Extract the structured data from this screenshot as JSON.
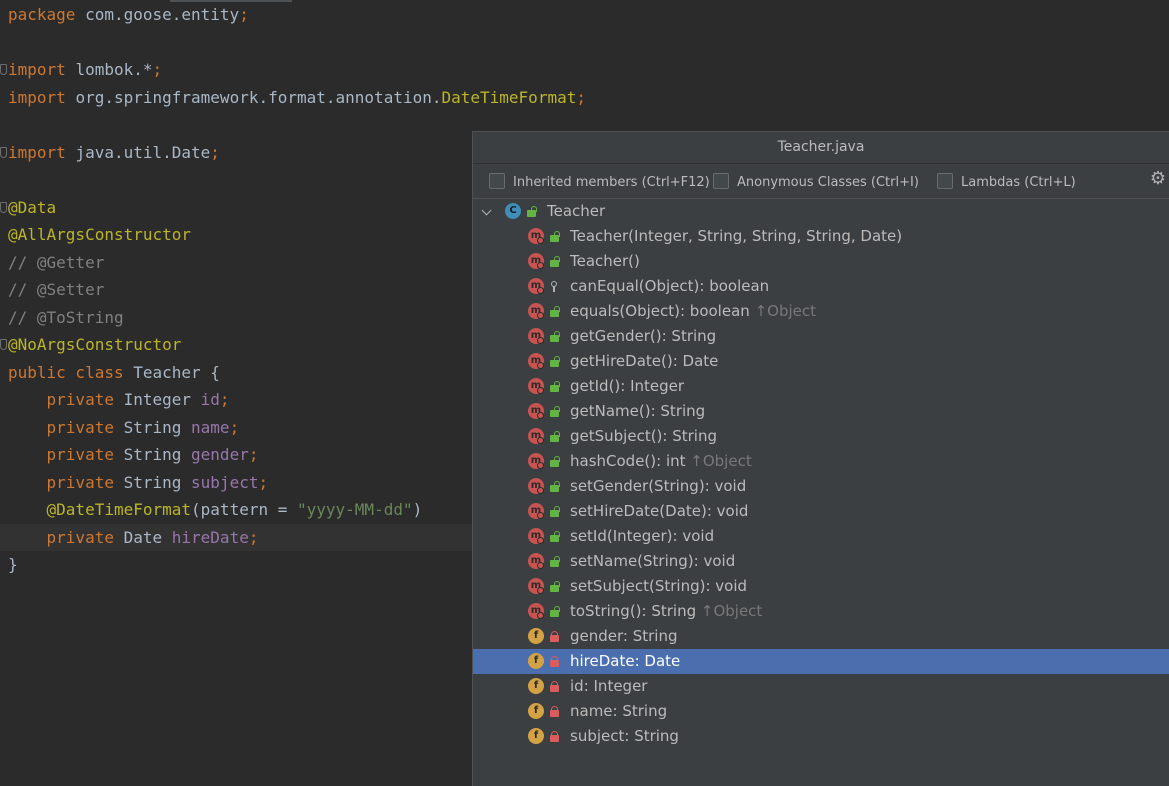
{
  "editor": {
    "lines": [
      {
        "segments": [
          {
            "t": "package ",
            "c": "kw"
          },
          {
            "t": "com.goose.entity",
            "c": ""
          },
          {
            "t": ";",
            "c": "kw"
          }
        ]
      },
      {
        "segments": []
      },
      {
        "mark": true,
        "segments": [
          {
            "t": "import ",
            "c": "kw"
          },
          {
            "t": "lombok.*",
            "c": ""
          },
          {
            "t": ";",
            "c": "kw"
          }
        ]
      },
      {
        "segments": [
          {
            "t": "import ",
            "c": "kw"
          },
          {
            "t": "org.springframework.format.annotation.",
            "c": ""
          },
          {
            "t": "DateTimeFormat",
            "c": "typ"
          },
          {
            "t": ";",
            "c": "kw"
          }
        ]
      },
      {
        "segments": []
      },
      {
        "mark": true,
        "segments": [
          {
            "t": "import ",
            "c": "kw"
          },
          {
            "t": "java.util.Date",
            "c": ""
          },
          {
            "t": ";",
            "c": "kw"
          }
        ]
      },
      {
        "segments": []
      },
      {
        "mark": true,
        "segments": [
          {
            "t": "@Data",
            "c": "ann"
          }
        ]
      },
      {
        "segments": [
          {
            "t": "@AllArgsConstructor",
            "c": "ann"
          }
        ]
      },
      {
        "segments": [
          {
            "t": "// @Getter",
            "c": "cmt"
          }
        ]
      },
      {
        "segments": [
          {
            "t": "// @Setter",
            "c": "cmt"
          }
        ]
      },
      {
        "segments": [
          {
            "t": "// @ToString",
            "c": "cmt"
          }
        ]
      },
      {
        "mark": true,
        "segments": [
          {
            "t": "@NoArgsConstructor",
            "c": "ann"
          }
        ]
      },
      {
        "segments": [
          {
            "t": "public class ",
            "c": "kw"
          },
          {
            "t": "Teacher {",
            "c": ""
          }
        ]
      },
      {
        "segments": [
          {
            "t": "    private ",
            "c": "kw"
          },
          {
            "t": "Integer ",
            "c": ""
          },
          {
            "t": "id",
            "c": "fld"
          },
          {
            "t": ";",
            "c": "kw"
          }
        ]
      },
      {
        "segments": [
          {
            "t": "    private ",
            "c": "kw"
          },
          {
            "t": "String ",
            "c": ""
          },
          {
            "t": "name",
            "c": "fld"
          },
          {
            "t": ";",
            "c": "kw"
          }
        ]
      },
      {
        "segments": [
          {
            "t": "    private ",
            "c": "kw"
          },
          {
            "t": "String ",
            "c": ""
          },
          {
            "t": "gender",
            "c": "fld"
          },
          {
            "t": ";",
            "c": "kw"
          }
        ]
      },
      {
        "segments": [
          {
            "t": "    private ",
            "c": "kw"
          },
          {
            "t": "String ",
            "c": ""
          },
          {
            "t": "subject",
            "c": "fld"
          },
          {
            "t": ";",
            "c": "kw"
          }
        ]
      },
      {
        "segments": [
          {
            "t": "    @DateTimeFormat",
            "c": "ann"
          },
          {
            "t": "(pattern = ",
            "c": ""
          },
          {
            "t": "\"yyyy-MM-dd\"",
            "c": "str"
          },
          {
            "t": ")",
            "c": ""
          }
        ]
      },
      {
        "current": true,
        "segments": [
          {
            "t": "    private ",
            "c": "kw"
          },
          {
            "t": "Date ",
            "c": ""
          },
          {
            "t": "hireDate",
            "c": "fld"
          },
          {
            "t": ";",
            "c": "kw"
          }
        ]
      },
      {
        "segments": [
          {
            "t": "}",
            "c": ""
          }
        ]
      }
    ]
  },
  "popup": {
    "title": "Teacher.java",
    "options": [
      {
        "label": "Inherited members (Ctrl+F12)",
        "checked": false
      },
      {
        "label": "Anonymous Classes (Ctrl+I)",
        "checked": false
      },
      {
        "label": "Lambdas (Ctrl+L)",
        "checked": false
      }
    ],
    "settings_icon": "gear-icon",
    "root": {
      "label": "Teacher",
      "icon": "class-icon",
      "expanded": true
    },
    "members": [
      {
        "label": "Teacher(Integer, String, String, String, Date)",
        "kind": "method",
        "visibility": "public"
      },
      {
        "label": "Teacher()",
        "kind": "method",
        "visibility": "public"
      },
      {
        "label": "canEqual(Object): boolean",
        "kind": "method",
        "visibility": "protected"
      },
      {
        "label": "equals(Object): boolean ",
        "inherit": "↑Object",
        "kind": "method",
        "visibility": "public"
      },
      {
        "label": "getGender(): String",
        "kind": "method",
        "visibility": "public"
      },
      {
        "label": "getHireDate(): Date",
        "kind": "method",
        "visibility": "public"
      },
      {
        "label": "getId(): Integer",
        "kind": "method",
        "visibility": "public"
      },
      {
        "label": "getName(): String",
        "kind": "method",
        "visibility": "public"
      },
      {
        "label": "getSubject(): String",
        "kind": "method",
        "visibility": "public"
      },
      {
        "label": "hashCode(): int ",
        "inherit": "↑Object",
        "kind": "method",
        "visibility": "public"
      },
      {
        "label": "setGender(String): void",
        "kind": "method",
        "visibility": "public"
      },
      {
        "label": "setHireDate(Date): void",
        "kind": "method",
        "visibility": "public"
      },
      {
        "label": "setId(Integer): void",
        "kind": "method",
        "visibility": "public"
      },
      {
        "label": "setName(String): void",
        "kind": "method",
        "visibility": "public"
      },
      {
        "label": "setSubject(String): void",
        "kind": "method",
        "visibility": "public"
      },
      {
        "label": "toString(): String ",
        "inherit": "↑Object",
        "kind": "method",
        "visibility": "public"
      },
      {
        "label": "gender: String",
        "kind": "field",
        "visibility": "private"
      },
      {
        "label": "hireDate: Date",
        "kind": "field",
        "visibility": "private",
        "selected": true
      },
      {
        "label": "id: Integer",
        "kind": "field",
        "visibility": "private"
      },
      {
        "label": "name: String",
        "kind": "field",
        "visibility": "private"
      },
      {
        "label": "subject: String",
        "kind": "field",
        "visibility": "private"
      }
    ],
    "colors": {
      "selection": "#4b6eaf",
      "method_icon": "#c75450",
      "field_icon": "#d3a244",
      "class_icon": "#3d8eb9",
      "public_lock": "#62b543",
      "private_lock": "#db5c5c"
    }
  }
}
